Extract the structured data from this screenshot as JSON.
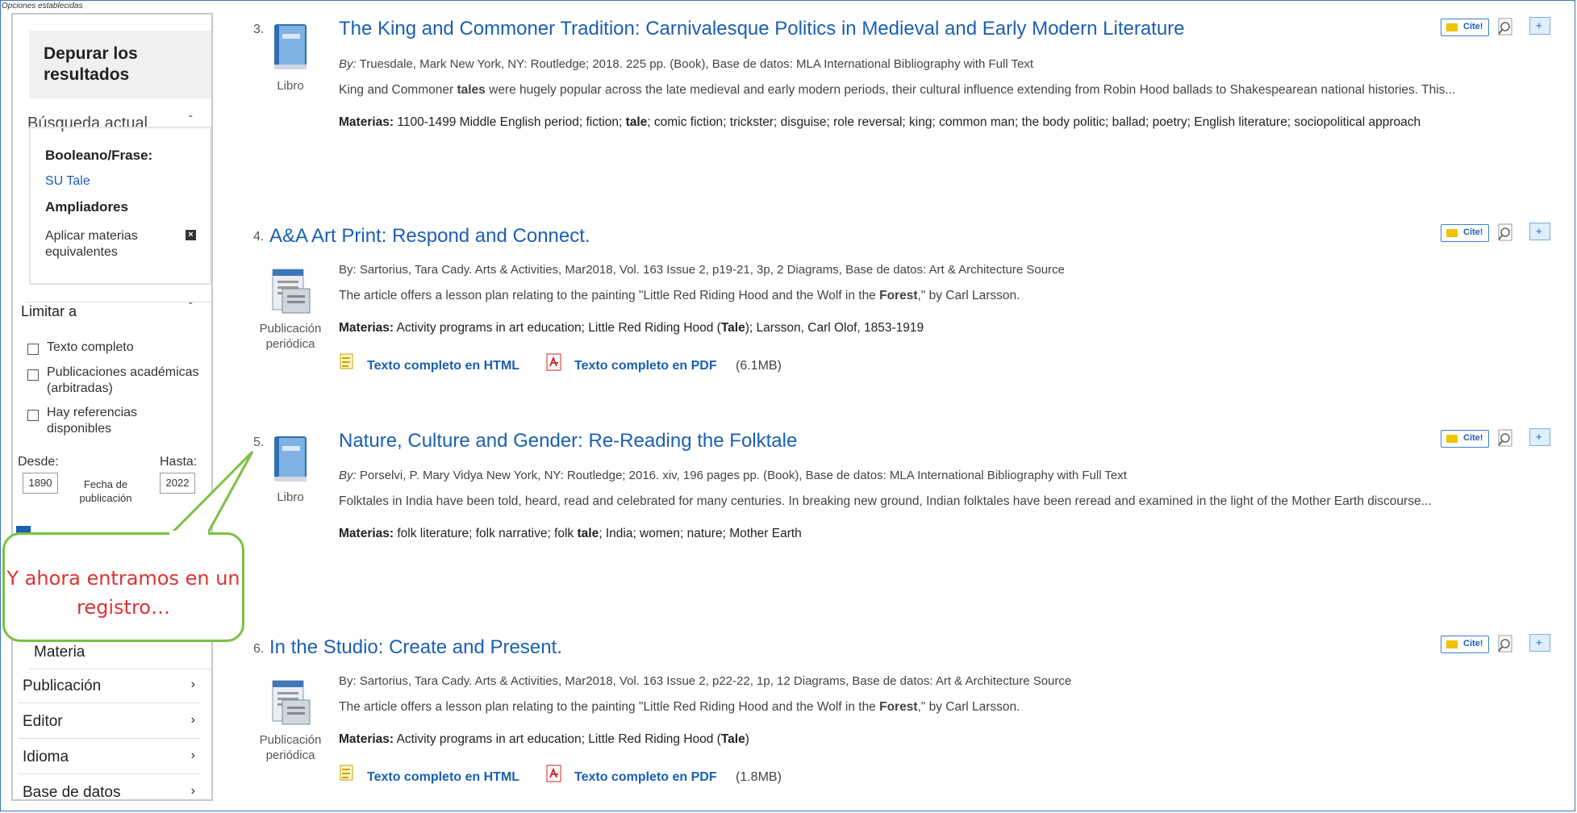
{
  "top_caption": "Opciones establecidas",
  "sidebar": {
    "heading": "Depurar los resultados",
    "current_search": {
      "title": "Búsqueda actual",
      "boolean_label": "Booleano/Frase:",
      "boolean_value": "SU Tale",
      "expanders_label": "Ampliadores",
      "expander_item": "Aplicar materias equivalentes"
    },
    "limit": {
      "title": "Limitar a",
      "options": [
        "Texto completo",
        "Publicaciones académicas (arbitradas)",
        "Hay referencias disponibles"
      ],
      "from_label": "Desde:",
      "to_label": "Hasta:",
      "from_value": "1890",
      "to_value": "2022",
      "date_caption": "Fecha de publicación"
    },
    "facets": [
      "Materia",
      "Publicación",
      "Editor",
      "Idioma",
      "Base de datos"
    ]
  },
  "callout": {
    "text": "Y ahora entramos en un registro…"
  },
  "results": [
    {
      "num": "3.",
      "title": "The King and Commoner Tradition: Carnivalesque Politics in Medieval and Early Modern Literature",
      "by_prefix": "By:",
      "by": "Truesdale, Mark New York, NY: Routledge; 2018. 225 pp. (Book), Base de datos: MLA International Bibliography with Full Text",
      "abstract_pre": "King and Commoner ",
      "abstract_bold": "tales",
      "abstract_post": " were hugely popular across the late medieval and early modern periods, their cultural influence extending from Robin Hood ballads to Shakespearean national histories. This...",
      "materias_label": "Materias:",
      "materias_pre": "1100-1499 Middle English period; fiction; ",
      "materias_bold": "tale",
      "materias_post": "; comic fiction; trickster; disguise; role reversal; king; common man; the body politic; ballad; poetry; English literature; sociopolitical approach",
      "type": "Libro"
    },
    {
      "num": "4.",
      "title": "A&A Art Print: Respond and Connect.",
      "by": "By: Sartorius, Tara Cady. Arts & Activities, Mar2018, Vol. 163 Issue 2, p19-21, 3p, 2 Diagrams, Base de datos: Art & Architecture Source",
      "abstract_pre": "The article offers a lesson plan relating to the painting \"Little Red Riding Hood and the Wolf in the ",
      "abstract_bold": "Forest",
      "abstract_post": ",\" by Carl Larsson.",
      "materias_label": "Materias:",
      "materias_pre": "Activity programs in art education; Little Red Riding Hood (",
      "materias_bold": "Tale",
      "materias_post": "); Larsson, Carl Olof, 1853-1919",
      "type_line1": "Publicación",
      "type_line2": "periódica",
      "ft_html": "Texto completo en HTML",
      "ft_pdf": "Texto completo en PDF",
      "pdf_size": "(6.1MB)"
    },
    {
      "num": "5.",
      "title": "Nature, Culture and Gender: Re-Reading the Folktale",
      "by_prefix": "By:",
      "by": "Porselvi, P. Mary Vidya New York, NY: Routledge; 2016. xiv, 196 pages pp. (Book), Base de datos: MLA International Bibliography with Full Text",
      "abstract": "Folktales in India have been told, heard, read and celebrated for many centuries. In breaking new ground, Indian folktales have been reread and examined in the light of the Mother Earth discourse...",
      "materias_label": "Materias:",
      "materias_pre": "folk literature; folk narrative; folk ",
      "materias_bold": "tale",
      "materias_post": "; India; women; nature; Mother Earth",
      "type": "Libro"
    },
    {
      "num": "6.",
      "title": "In the Studio: Create and Present.",
      "by": "By: Sartorius, Tara Cady. Arts & Activities, Mar2018, Vol. 163 Issue 2, p22-22, 1p, 12 Diagrams, Base de datos: Art & Architecture Source",
      "abstract_pre": "The article offers a lesson plan relating to the painting \"Little Red Riding Hood and the Wolf in the ",
      "abstract_bold": "Forest",
      "abstract_post": ",\" by Carl Larsson.",
      "materias_label": "Materias:",
      "materias_pre": "Activity programs in art education; Little Red Riding Hood (",
      "materias_bold": "Tale",
      "materias_post": ")",
      "type_line1": "Publicación",
      "type_line2": "periódica",
      "ft_html": "Texto completo en HTML",
      "ft_pdf": "Texto completo en PDF",
      "pdf_size": "(1.8MB)"
    }
  ],
  "tools": {
    "cite_label": "Cite!"
  },
  "colors": {
    "link": "#1a5fb4",
    "callout_border": "#7ac143",
    "callout_text": "#dd3333",
    "frame": "#3a73c4"
  }
}
